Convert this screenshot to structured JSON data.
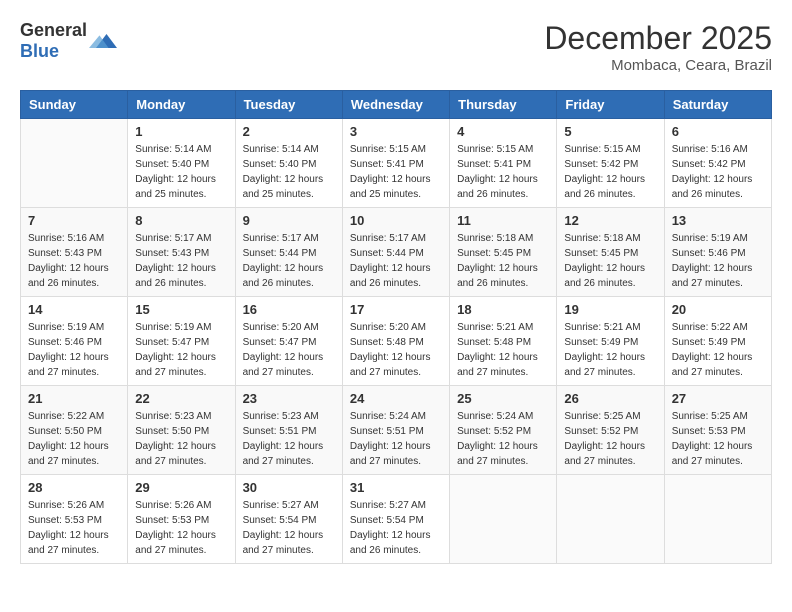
{
  "header": {
    "logo_general": "General",
    "logo_blue": "Blue",
    "month_year": "December 2025",
    "location": "Mombaca, Ceara, Brazil"
  },
  "days_of_week": [
    "Sunday",
    "Monday",
    "Tuesday",
    "Wednesday",
    "Thursday",
    "Friday",
    "Saturday"
  ],
  "weeks": [
    [
      {
        "day": "",
        "sunrise": "",
        "sunset": "",
        "daylight": ""
      },
      {
        "day": "1",
        "sunrise": "5:14 AM",
        "sunset": "5:40 PM",
        "daylight": "12 hours and 25 minutes."
      },
      {
        "day": "2",
        "sunrise": "5:14 AM",
        "sunset": "5:40 PM",
        "daylight": "12 hours and 25 minutes."
      },
      {
        "day": "3",
        "sunrise": "5:15 AM",
        "sunset": "5:41 PM",
        "daylight": "12 hours and 25 minutes."
      },
      {
        "day": "4",
        "sunrise": "5:15 AM",
        "sunset": "5:41 PM",
        "daylight": "12 hours and 26 minutes."
      },
      {
        "day": "5",
        "sunrise": "5:15 AM",
        "sunset": "5:42 PM",
        "daylight": "12 hours and 26 minutes."
      },
      {
        "day": "6",
        "sunrise": "5:16 AM",
        "sunset": "5:42 PM",
        "daylight": "12 hours and 26 minutes."
      }
    ],
    [
      {
        "day": "7",
        "sunrise": "5:16 AM",
        "sunset": "5:43 PM",
        "daylight": "12 hours and 26 minutes."
      },
      {
        "day": "8",
        "sunrise": "5:17 AM",
        "sunset": "5:43 PM",
        "daylight": "12 hours and 26 minutes."
      },
      {
        "day": "9",
        "sunrise": "5:17 AM",
        "sunset": "5:44 PM",
        "daylight": "12 hours and 26 minutes."
      },
      {
        "day": "10",
        "sunrise": "5:17 AM",
        "sunset": "5:44 PM",
        "daylight": "12 hours and 26 minutes."
      },
      {
        "day": "11",
        "sunrise": "5:18 AM",
        "sunset": "5:45 PM",
        "daylight": "12 hours and 26 minutes."
      },
      {
        "day": "12",
        "sunrise": "5:18 AM",
        "sunset": "5:45 PM",
        "daylight": "12 hours and 26 minutes."
      },
      {
        "day": "13",
        "sunrise": "5:19 AM",
        "sunset": "5:46 PM",
        "daylight": "12 hours and 27 minutes."
      }
    ],
    [
      {
        "day": "14",
        "sunrise": "5:19 AM",
        "sunset": "5:46 PM",
        "daylight": "12 hours and 27 minutes."
      },
      {
        "day": "15",
        "sunrise": "5:19 AM",
        "sunset": "5:47 PM",
        "daylight": "12 hours and 27 minutes."
      },
      {
        "day": "16",
        "sunrise": "5:20 AM",
        "sunset": "5:47 PM",
        "daylight": "12 hours and 27 minutes."
      },
      {
        "day": "17",
        "sunrise": "5:20 AM",
        "sunset": "5:48 PM",
        "daylight": "12 hours and 27 minutes."
      },
      {
        "day": "18",
        "sunrise": "5:21 AM",
        "sunset": "5:48 PM",
        "daylight": "12 hours and 27 minutes."
      },
      {
        "day": "19",
        "sunrise": "5:21 AM",
        "sunset": "5:49 PM",
        "daylight": "12 hours and 27 minutes."
      },
      {
        "day": "20",
        "sunrise": "5:22 AM",
        "sunset": "5:49 PM",
        "daylight": "12 hours and 27 minutes."
      }
    ],
    [
      {
        "day": "21",
        "sunrise": "5:22 AM",
        "sunset": "5:50 PM",
        "daylight": "12 hours and 27 minutes."
      },
      {
        "day": "22",
        "sunrise": "5:23 AM",
        "sunset": "5:50 PM",
        "daylight": "12 hours and 27 minutes."
      },
      {
        "day": "23",
        "sunrise": "5:23 AM",
        "sunset": "5:51 PM",
        "daylight": "12 hours and 27 minutes."
      },
      {
        "day": "24",
        "sunrise": "5:24 AM",
        "sunset": "5:51 PM",
        "daylight": "12 hours and 27 minutes."
      },
      {
        "day": "25",
        "sunrise": "5:24 AM",
        "sunset": "5:52 PM",
        "daylight": "12 hours and 27 minutes."
      },
      {
        "day": "26",
        "sunrise": "5:25 AM",
        "sunset": "5:52 PM",
        "daylight": "12 hours and 27 minutes."
      },
      {
        "day": "27",
        "sunrise": "5:25 AM",
        "sunset": "5:53 PM",
        "daylight": "12 hours and 27 minutes."
      }
    ],
    [
      {
        "day": "28",
        "sunrise": "5:26 AM",
        "sunset": "5:53 PM",
        "daylight": "12 hours and 27 minutes."
      },
      {
        "day": "29",
        "sunrise": "5:26 AM",
        "sunset": "5:53 PM",
        "daylight": "12 hours and 27 minutes."
      },
      {
        "day": "30",
        "sunrise": "5:27 AM",
        "sunset": "5:54 PM",
        "daylight": "12 hours and 27 minutes."
      },
      {
        "day": "31",
        "sunrise": "5:27 AM",
        "sunset": "5:54 PM",
        "daylight": "12 hours and 26 minutes."
      },
      {
        "day": "",
        "sunrise": "",
        "sunset": "",
        "daylight": ""
      },
      {
        "day": "",
        "sunrise": "",
        "sunset": "",
        "daylight": ""
      },
      {
        "day": "",
        "sunrise": "",
        "sunset": "",
        "daylight": ""
      }
    ]
  ]
}
